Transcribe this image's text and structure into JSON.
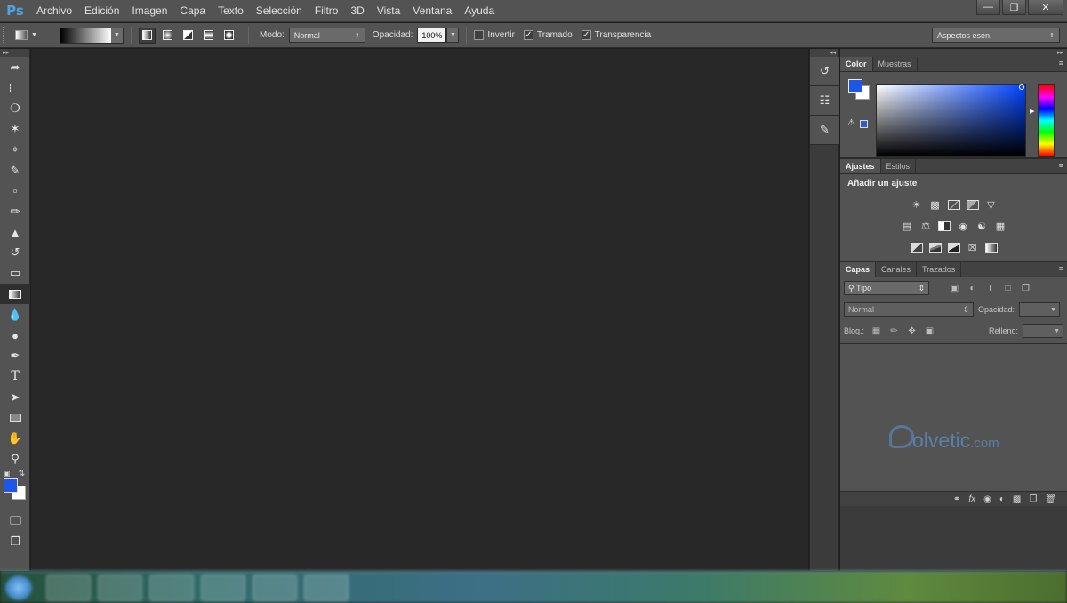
{
  "app": {
    "logo": "Ps",
    "menu": [
      "Archivo",
      "Edición",
      "Imagen",
      "Capa",
      "Texto",
      "Selección",
      "Filtro",
      "3D",
      "Vista",
      "Ventana",
      "Ayuda"
    ],
    "window_controls": [
      "minimize",
      "restore",
      "close"
    ]
  },
  "options_bar": {
    "mode_label": "Modo:",
    "mode_value": "Normal",
    "opacity_label": "Opacidad:",
    "opacity_value": "100%",
    "invert_label": "Invertir",
    "invert_checked": false,
    "dither_label": "Tramado",
    "dither_checked": true,
    "transparency_label": "Transparencia",
    "transparency_checked": true,
    "workspace": "Aspectos esen."
  },
  "toolbar": {
    "active_tool": "gradient-tool",
    "foreground_color": "#1e56e5",
    "background_color": "#ffffff"
  },
  "panels": {
    "color": {
      "tabs": [
        "Color",
        "Muestras"
      ],
      "active_tab": "Color"
    },
    "adjustments": {
      "tabs": [
        "Ajustes",
        "Estilos"
      ],
      "active_tab": "Ajustes",
      "title": "Añadir un ajuste"
    },
    "layers": {
      "tabs": [
        "Capas",
        "Canales",
        "Trazados"
      ],
      "active_tab": "Capas",
      "filter_value": "Tipo",
      "blend_mode": "Normal",
      "opacity_label": "Opacidad:",
      "lock_label": "Bloq.:",
      "fill_label": "Relleno:"
    }
  },
  "watermark": {
    "text": "olvetic",
    "suffix": ".com"
  },
  "colors": {
    "chrome": "#535353",
    "canvas": "#282828",
    "accent": "#1e56e5"
  }
}
